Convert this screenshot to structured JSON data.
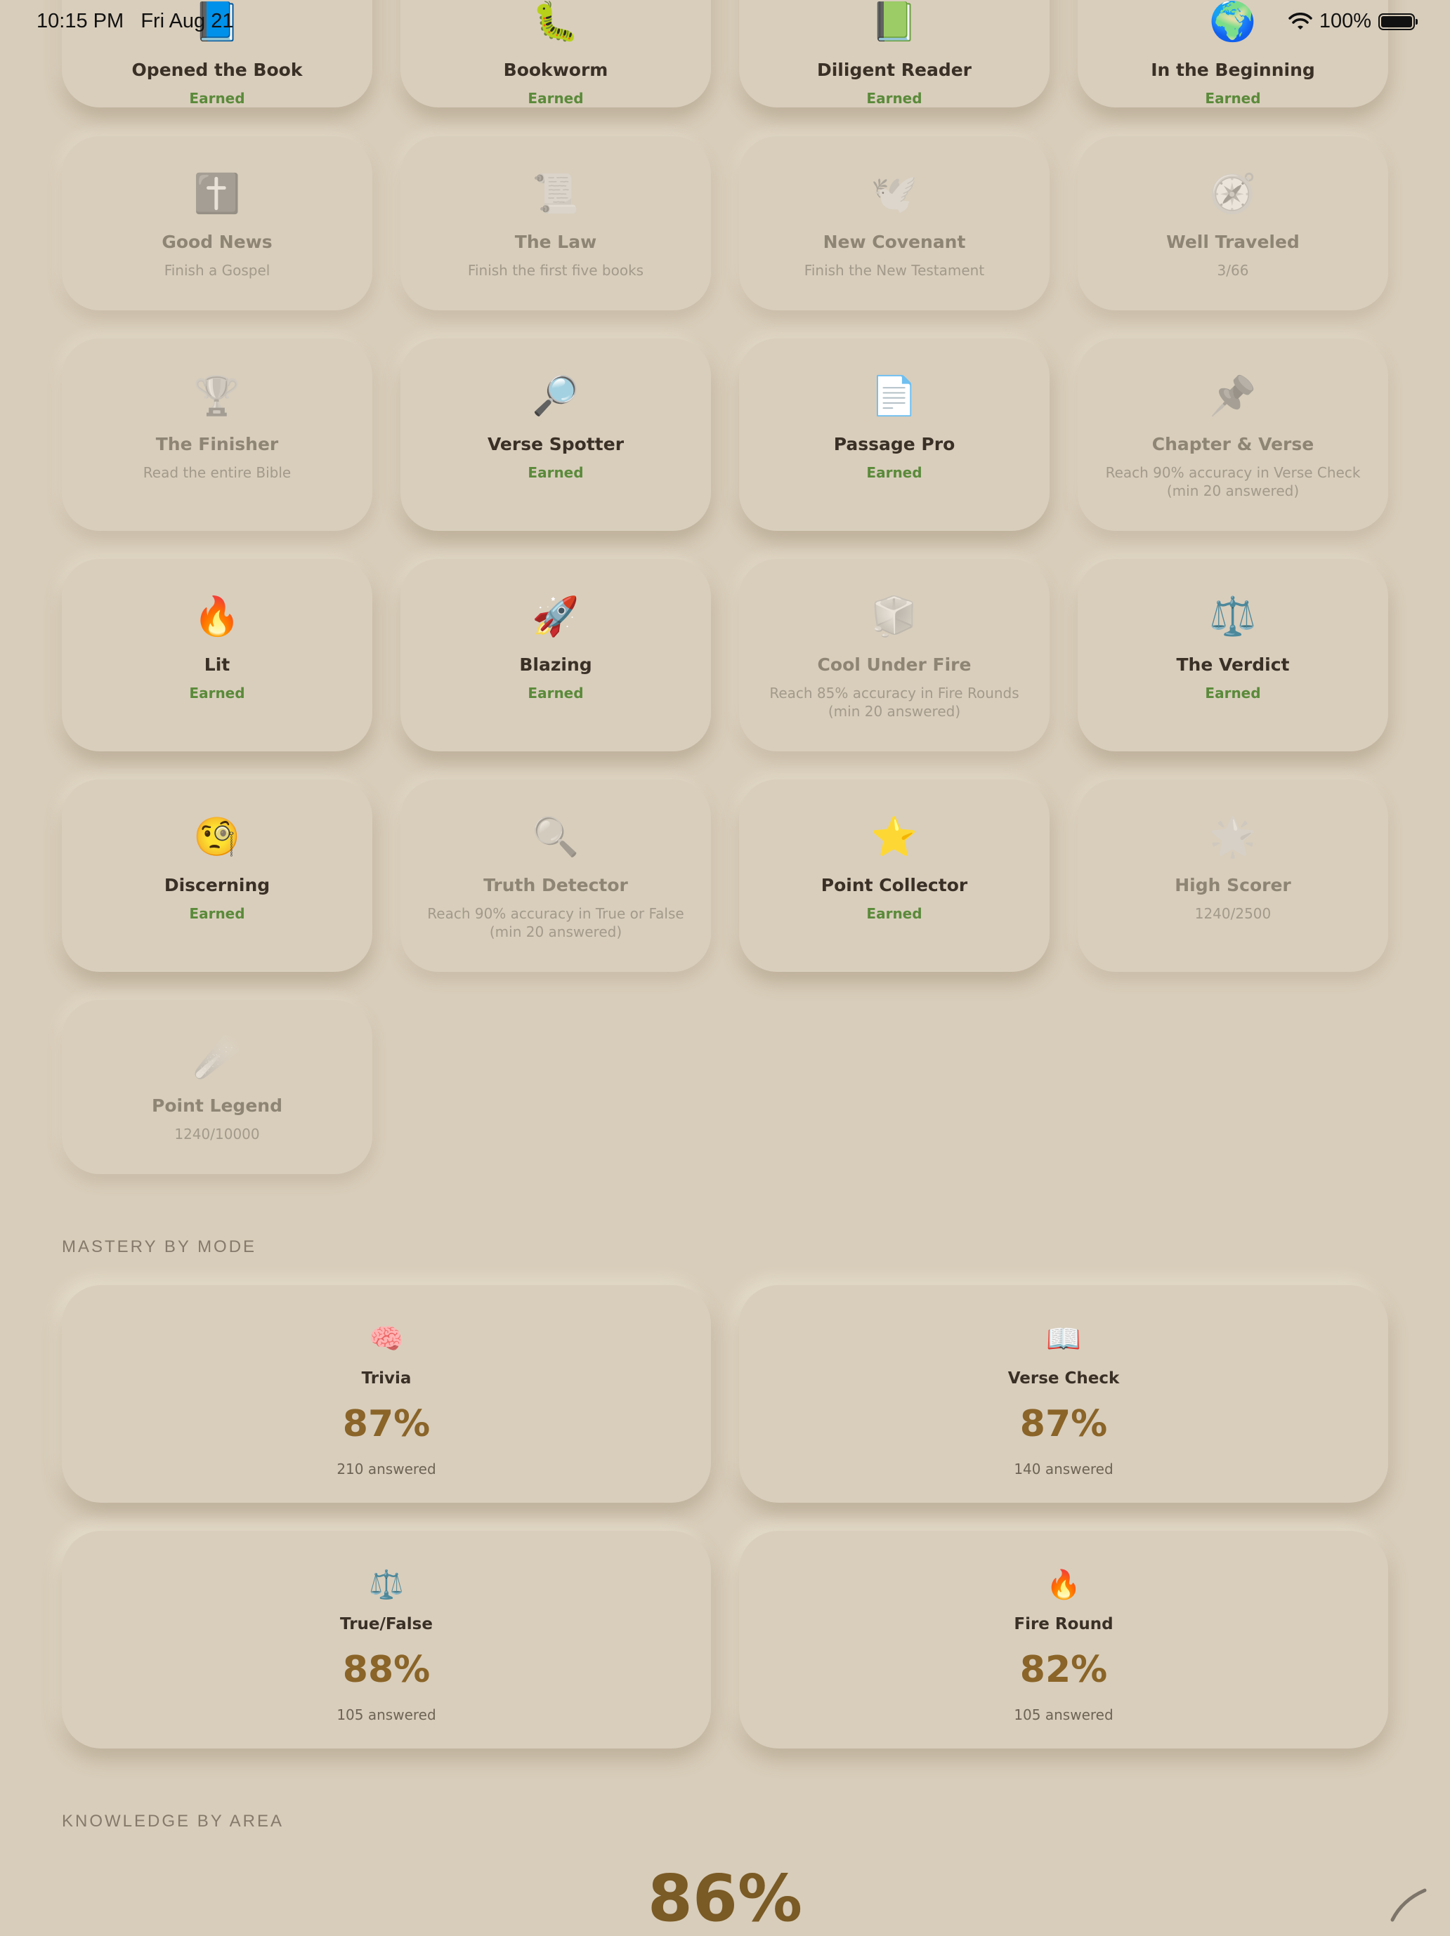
{
  "status_bar": {
    "time": "10:15 PM",
    "date": "Fri Aug 21",
    "battery": "100%"
  },
  "badges": [
    {
      "name": "Opened the Book",
      "sub": "Earned",
      "earned": true,
      "icon": "📘",
      "icon_name": "book-icon"
    },
    {
      "name": "Bookworm",
      "sub": "Earned",
      "earned": true,
      "icon": "🐛",
      "icon_name": "bookworm-icon"
    },
    {
      "name": "Diligent Reader",
      "sub": "Earned",
      "earned": true,
      "icon": "📗",
      "icon_name": "green-book-icon"
    },
    {
      "name": "In the Beginning",
      "sub": "Earned",
      "earned": true,
      "icon": "🌍",
      "icon_name": "globe-icon"
    },
    {
      "name": "Good News",
      "sub": "Finish a Gospel",
      "earned": false,
      "icon": "✝️",
      "icon_name": "cross-icon"
    },
    {
      "name": "The Law",
      "sub": "Finish the first five books",
      "earned": false,
      "icon": "📜",
      "icon_name": "scroll-icon"
    },
    {
      "name": "New Covenant",
      "sub": "Finish the New Testament",
      "earned": false,
      "icon": "🕊️",
      "icon_name": "dove-icon"
    },
    {
      "name": "Well Traveled",
      "sub": "3/66",
      "earned": false,
      "icon": "🧭",
      "icon_name": "compass-icon"
    },
    {
      "name": "The Finisher",
      "sub": "Read the entire Bible",
      "earned": false,
      "icon": "🏆",
      "icon_name": "trophy-icon"
    },
    {
      "name": "Verse Spotter",
      "sub": "Earned",
      "earned": true,
      "icon": "🔎",
      "icon_name": "magnifier-right-icon"
    },
    {
      "name": "Passage Pro",
      "sub": "Earned",
      "earned": true,
      "icon": "📄",
      "icon_name": "document-icon"
    },
    {
      "name": "Chapter & Verse",
      "sub": "Reach 90% accuracy in Verse Check (min 20 answered)",
      "earned": false,
      "icon": "📌",
      "icon_name": "pushpin-icon"
    },
    {
      "name": "Lit",
      "sub": "Earned",
      "earned": true,
      "icon": "🔥",
      "icon_name": "fire-icon"
    },
    {
      "name": "Blazing",
      "sub": "Earned",
      "earned": true,
      "icon": "🚀",
      "icon_name": "rocket-icon"
    },
    {
      "name": "Cool Under Fire",
      "sub": "Reach 85% accuracy in Fire Rounds (min 20 answered)",
      "earned": false,
      "icon": "🧊",
      "icon_name": "ice-cube-icon"
    },
    {
      "name": "The Verdict",
      "sub": "Earned",
      "earned": true,
      "icon": "⚖️",
      "icon_name": "scales-icon"
    },
    {
      "name": "Discerning",
      "sub": "Earned",
      "earned": true,
      "icon": "🧐",
      "icon_name": "monocle-face-icon"
    },
    {
      "name": "Truth Detector",
      "sub": "Reach 90% accuracy in True or False (min 20 answered)",
      "earned": false,
      "icon": "🔍",
      "icon_name": "magnifier-left-icon"
    },
    {
      "name": "Point Collector",
      "sub": "Earned",
      "earned": true,
      "icon": "⭐",
      "icon_name": "star-icon"
    },
    {
      "name": "High Scorer",
      "sub": "1240/2500",
      "earned": false,
      "icon": "🌟",
      "icon_name": "glowing-star-icon"
    },
    {
      "name": "Point Legend",
      "sub": "1240/10000",
      "earned": false,
      "icon": "☄️",
      "icon_name": "comet-icon"
    }
  ],
  "mastery": {
    "title": "MASTERY BY MODE",
    "modes": [
      {
        "name": "Trivia",
        "pct": "87%",
        "count": "210 answered",
        "icon": "🧠",
        "icon_name": "brain-icon"
      },
      {
        "name": "Verse Check",
        "pct": "87%",
        "count": "140 answered",
        "icon": "📖",
        "icon_name": "open-book-icon"
      },
      {
        "name": "True/False",
        "pct": "88%",
        "count": "105 answered",
        "icon": "⚖️",
        "icon_name": "scales-icon"
      },
      {
        "name": "Fire Round",
        "pct": "82%",
        "count": "105 answered",
        "icon": "🔥",
        "icon_name": "fire-icon"
      }
    ]
  },
  "knowledge": {
    "title": "KNOWLEDGE BY AREA",
    "overall": "86%"
  }
}
